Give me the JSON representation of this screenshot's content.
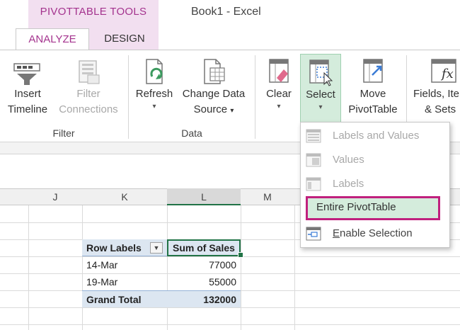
{
  "window": {
    "context_title": "PIVOTTABLE TOOLS",
    "book_title": "Book1 - Excel"
  },
  "tabs": [
    {
      "label": "ANALYZE",
      "active": true
    },
    {
      "label": "DESIGN",
      "active": false
    }
  ],
  "ribbon": {
    "groups": {
      "filter": "Filter",
      "data": "Data"
    },
    "buttons": {
      "insert_timeline": {
        "line1": "Insert",
        "line2": "Timeline"
      },
      "filter_connections": {
        "line1": "Filter",
        "line2": "Connections"
      },
      "refresh": {
        "line1": "Refresh"
      },
      "change_data_source": {
        "line1": "Change Data",
        "line2": "Source"
      },
      "clear": {
        "line1": "Clear"
      },
      "select": {
        "line1": "Select"
      },
      "move_pivottable": {
        "line1": "Move",
        "line2": "PivotTable"
      },
      "fields_items_sets": {
        "line1": "Fields, Ite",
        "line2": "& Sets"
      }
    }
  },
  "select_menu": {
    "items": [
      {
        "label": "Labels and Values",
        "enabled": false
      },
      {
        "label": "Values",
        "enabled": false
      },
      {
        "label": "Labels",
        "enabled": false
      },
      {
        "label": "Entire PivotTable",
        "enabled": true,
        "highlighted": true
      },
      {
        "label": "Enable Selection",
        "enabled": true
      }
    ]
  },
  "grid": {
    "columns": [
      "J",
      "K",
      "L",
      "M"
    ],
    "selected_column": "L"
  },
  "pivot": {
    "header_row_labels": "Row Labels",
    "header_sum": "Sum of Sales",
    "rows": [
      {
        "label": "14-Mar",
        "value": "77000"
      },
      {
        "label": "19-Mar",
        "value": "55000"
      }
    ],
    "total_label": "Grand Total",
    "total_value": "132000"
  },
  "colors": {
    "accent": "#a4338e",
    "excel_green": "#217346",
    "highlight": "#c0207e"
  }
}
